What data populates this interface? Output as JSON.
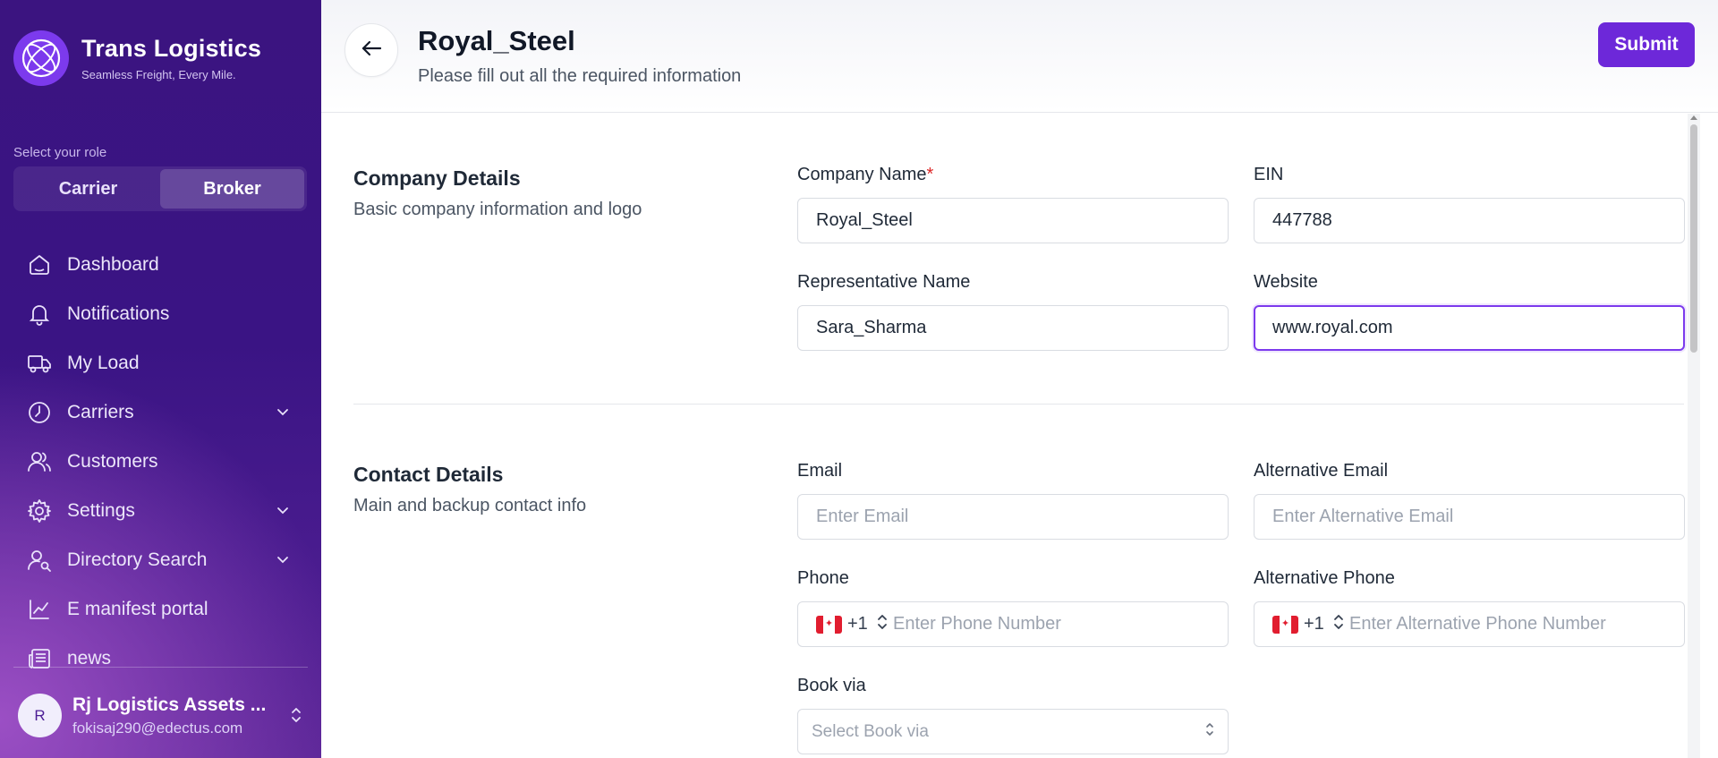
{
  "brand": {
    "title": "Trans Logistics",
    "tagline": "Seamless Freight, Every Mile."
  },
  "role": {
    "label": "Select your role",
    "options": [
      "Carrier",
      "Broker"
    ],
    "selected": "Broker"
  },
  "nav": {
    "items": [
      {
        "label": "Dashboard",
        "icon": "dashboard-icon"
      },
      {
        "label": "Notifications",
        "icon": "bell-icon"
      },
      {
        "label": "My Load",
        "icon": "truck-icon"
      },
      {
        "label": "Carriers",
        "icon": "gauge-icon",
        "expandable": true
      },
      {
        "label": "Customers",
        "icon": "users-icon"
      },
      {
        "label": "Settings",
        "icon": "gear-icon",
        "expandable": true
      },
      {
        "label": "Directory Search",
        "icon": "user-search-icon",
        "expandable": true
      },
      {
        "label": "E manifest portal",
        "icon": "chart-line-icon"
      },
      {
        "label": "news",
        "icon": "newspaper-icon"
      }
    ]
  },
  "user": {
    "initial": "R",
    "name": "Rj Logistics Assets ...",
    "email": "fokisaj290@edectus.com"
  },
  "header": {
    "title": "Royal_Steel",
    "subtitle": "Please fill out all the required information",
    "submit_label": "Submit"
  },
  "company": {
    "title": "Company Details",
    "description": "Basic company information and logo",
    "company_name": {
      "label": "Company Name",
      "required_mark": "*",
      "value": "Royal_Steel"
    },
    "ein": {
      "label": "EIN",
      "value": "447788"
    },
    "representative": {
      "label": "Representative Name",
      "value": "Sara_Sharma"
    },
    "website": {
      "label": "Website",
      "value": "www.royal.com"
    }
  },
  "contact": {
    "title": "Contact Details",
    "description": "Main and backup contact info",
    "email": {
      "label": "Email",
      "placeholder": "Enter Email",
      "value": ""
    },
    "alt_email": {
      "label": "Alternative Email",
      "placeholder": "Enter Alternative Email",
      "value": ""
    },
    "phone": {
      "label": "Phone",
      "dial_code": "+1",
      "country": "CA",
      "placeholder": "Enter Phone Number"
    },
    "alt_phone": {
      "label": "Alternative Phone",
      "dial_code": "+1",
      "country": "CA",
      "placeholder": "Enter Alternative Phone Number"
    },
    "book_via": {
      "label": "Book via",
      "placeholder": "Select Book via"
    }
  },
  "colors": {
    "accent": "#6d28d9",
    "sidebar": "#3b1480",
    "required": "#dc2626"
  }
}
